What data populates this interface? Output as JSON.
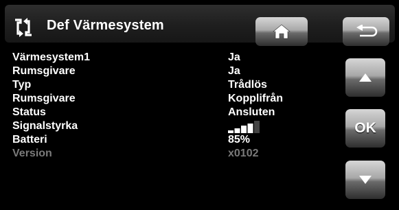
{
  "header": {
    "title": "Def Värmesystem",
    "icons": {
      "left": "sync-arrows-icon",
      "home": "home-icon",
      "back": "return-arrow-icon"
    }
  },
  "rows": [
    {
      "label": "Värmesystem1",
      "value": "Ja"
    },
    {
      "label": "Rumsgivare",
      "value": "Ja"
    },
    {
      "label": "Typ",
      "value": "Trådlös"
    },
    {
      "label": "Rumsgivare",
      "value": "Kopplifrån"
    },
    {
      "label": "Status",
      "value": "Ansluten"
    },
    {
      "label": "Signalstyrka",
      "signal_level": 4,
      "signal_max": 5
    },
    {
      "label": "Batteri",
      "value": "85%"
    },
    {
      "label": "Version",
      "value": "x0102",
      "dimmed": true
    }
  ],
  "side_buttons": {
    "ok_label": "OK",
    "icons": {
      "up": "triangle-up-icon",
      "down": "triangle-down-icon"
    }
  },
  "colors": {
    "background": "#000000",
    "text": "#ffffff",
    "dimmed_text": "#7a7a7a"
  }
}
